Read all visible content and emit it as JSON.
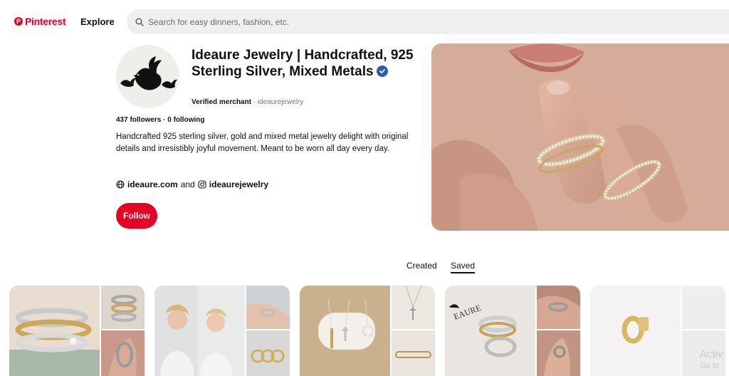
{
  "header": {
    "logo_text": "Pinterest",
    "explore_label": "Explore",
    "search_placeholder": "Search for easy dinners, fashion, etc."
  },
  "profile": {
    "name": "Ideaure Jewelry | Handcrafted, 925 Sterling Silver, Mixed Metals",
    "merchant_label": "Verified merchant",
    "separator": "·",
    "handle": "ideaurejewelry",
    "followers": "437 followers · 0 following",
    "bio": "Handcrafted 925 sterling silver, gold and mixed metal jewelry delight with original details and irresistibly joyful movement. Meant to be worn all day every day.",
    "website": "ideaure.com",
    "links_connector": "and",
    "instagram": "ideaurejewelry",
    "follow_label": "Follow"
  },
  "tabs": {
    "created": "Created",
    "saved": "Saved"
  },
  "watermark": {
    "line1": "Activ",
    "line2": "Go to"
  },
  "colors": {
    "brand": "#e60023",
    "verified": "#2f5ba8",
    "search_bg": "#efefef"
  },
  "icons": [
    "pinterest-logo-icon",
    "search-icon",
    "verified-check-icon",
    "globe-icon",
    "instagram-icon"
  ]
}
